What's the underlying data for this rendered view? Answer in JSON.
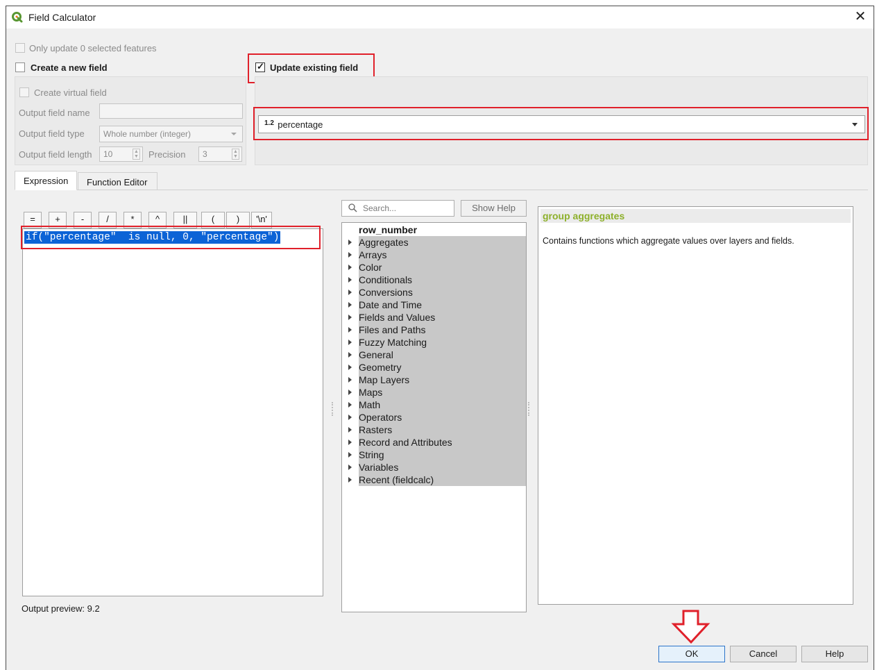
{
  "window": {
    "title": "Field Calculator"
  },
  "top": {
    "only_update_label": "Only update 0 selected features",
    "create_new_field_label": "Create a new field",
    "update_existing_label": "Update existing field"
  },
  "new_field": {
    "virtual_label": "Create virtual field",
    "name_label": "Output field name",
    "name_value": "",
    "type_label": "Output field type",
    "type_value": "Whole number (integer)",
    "length_label": "Output field length",
    "length_value": "10",
    "precision_label": "Precision",
    "precision_value": "3"
  },
  "existing_field": {
    "type_badge": "1.2",
    "selected": "percentage"
  },
  "tabs": [
    "Expression",
    "Function Editor"
  ],
  "operators": [
    "=",
    "+",
    "-",
    "/",
    "*",
    "^",
    "||",
    "(",
    ")",
    "'\\n'"
  ],
  "expression": "if(\"percentage\"  is null, 0, \"percentage\")",
  "output_preview": "Output preview:  9.2",
  "search": {
    "placeholder": "Search...",
    "show_help": "Show Help"
  },
  "tree": {
    "top": "row_number",
    "groups": [
      "Aggregates",
      "Arrays",
      "Color",
      "Conditionals",
      "Conversions",
      "Date and Time",
      "Fields and Values",
      "Files and Paths",
      "Fuzzy Matching",
      "General",
      "Geometry",
      "Map Layers",
      "Maps",
      "Math",
      "Operators",
      "Rasters",
      "Record and Attributes",
      "String",
      "Variables",
      "Recent (fieldcalc)"
    ]
  },
  "help": {
    "title": "group aggregates",
    "text": "Contains functions which aggregate values over layers and fields.",
    "title_color": "#8db02a"
  },
  "buttons": {
    "ok": "OK",
    "cancel": "Cancel",
    "help": "Help"
  },
  "colors": {
    "highlight": "#e0202a",
    "selection": "#0c63d6"
  }
}
